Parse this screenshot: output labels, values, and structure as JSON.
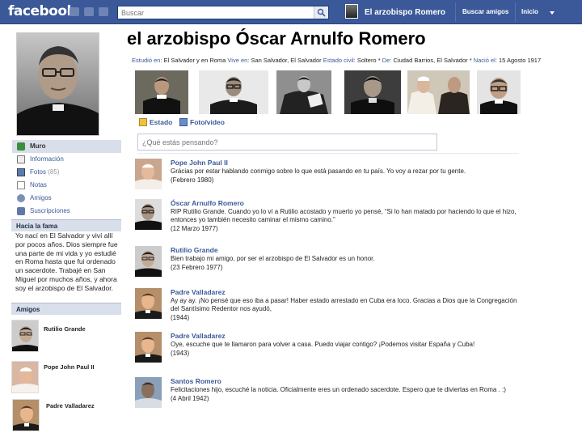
{
  "topbar": {
    "logo": "facebook",
    "search_placeholder": "Buscar",
    "profile_name": "El arzobispo Romero",
    "find_friends": "Buscar amigos",
    "home": "Inicio"
  },
  "profile": {
    "title": "el arzobispo Óscar Arnulfo Romero",
    "info": [
      {
        "label": "Estudió en:",
        "value": "El Salvador y en Roma"
      },
      {
        "label": "Vive en:",
        "value": "San Salvador, El Salvador"
      },
      {
        "label": "Estado civil:",
        "value": "Soltero *"
      },
      {
        "label": "De:",
        "value": "Ciudad Barrios, El Salvador *"
      },
      {
        "label": "Nació el:",
        "value": "15 Agosto 1917"
      }
    ]
  },
  "left_nav": {
    "items": [
      {
        "label": "Muro",
        "count": ""
      },
      {
        "label": "Información",
        "count": ""
      },
      {
        "label": "Fotos",
        "count": "(85)"
      },
      {
        "label": "Notas",
        "count": ""
      },
      {
        "label": "Amigos",
        "count": ""
      },
      {
        "label": "Suscripciones",
        "count": ""
      }
    ],
    "about_heading": "Hacia la fama",
    "about_text": "Yo nací en El Salvador y viví allí por pocos años. Dios siempre fue una parte de mi vida y yo estudié en Roma hasta que fui ordenado un sacerdote. Trabajé en San Miguel por muchos años, y ahora soy el arzobispo de El Salvador.",
    "friends_heading": "Amigos",
    "friends": [
      "Rutilio Grande",
      "Pope John Paul II",
      "Padre Valladarez"
    ]
  },
  "tabs": {
    "status": "Estado",
    "photo": "Foto/video"
  },
  "composer": {
    "placeholder": "¿Qué estás pensando?"
  },
  "posts": [
    {
      "author": "Pope John Paul II",
      "text": "Grácias por estar hablando conmigo sobre lo que está pasando en tu país. Yo voy a rezar por tu gente.",
      "date": "(Febrero 1980)"
    },
    {
      "author": "Óscar Arnulfo Romero",
      "text": "RIP Rutilio Grande. Cuando yo lo ví a Rutilio acostado y muerto yo pensé, “Si lo han matado por haciendo lo que el hizo, entonces yo también necesito caminar el mismo camino.”",
      "date": "(12 Marzo 1977)"
    },
    {
      "author": "Rutilio Grande",
      "text": "Bien trabajo mi amigo, por ser el arzobispo de El Salvador es un honor.",
      "date": "(23 Febrero 1977)"
    },
    {
      "author": "Padre Valladarez",
      "text": "Ay ay ay. ¡No pensé que eso iba a pasar! Haber estado arrestado en Cuba era loco. Gracias a Dios que la Congregación del Santísimo Redentor nos ayudó,",
      "date": "(1944)"
    },
    {
      "author": "Padre Valladarez",
      "text": "Oye, escuche que te llamaron para volver a casa. Puedo viajar contigo? ¡Podemos visitar España y Cuba!",
      "date": "(1943)"
    },
    {
      "author": "Santos Romero",
      "text": "Felicitaciones hijo, escuché la noticia. Oficialmente eres un ordenado sacerdote. Espero que te diviertas en Roma . :)",
      "date": "(4 Abril 1942)"
    }
  ],
  "colors": {
    "brand": "#3b5998",
    "nav_bg": "#d8dfea"
  },
  "icons": [
    "friends-icon",
    "messages-icon",
    "notifications-icon",
    "search-icon",
    "home-dropdown-icon",
    "wall-icon",
    "info-icon",
    "photos-icon",
    "notes-icon",
    "friends-nav-icon",
    "subscriptions-icon",
    "status-icon",
    "photo-video-icon"
  ]
}
